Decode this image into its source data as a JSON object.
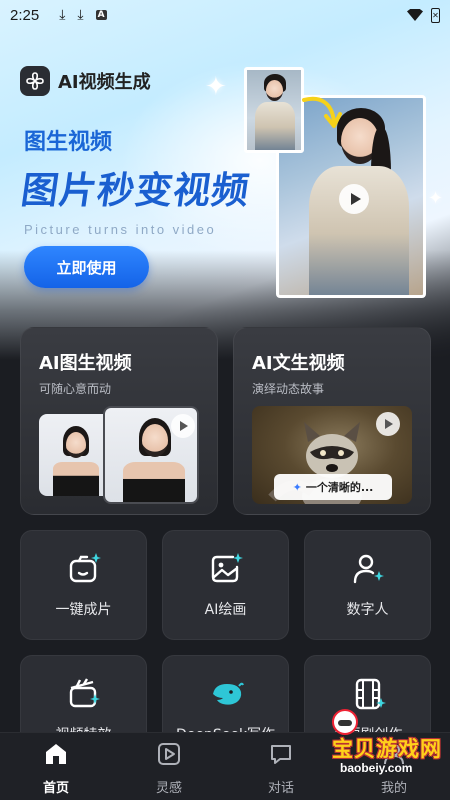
{
  "status": {
    "time": "2:25",
    "icons": [
      "download-icon",
      "download-icon",
      "a-badge-icon"
    ]
  },
  "app": {
    "title": "AI视频生成"
  },
  "hero": {
    "subtitle": "图生视频",
    "headline": "图片秒变视频",
    "english": "Picture turns into video",
    "cta_label": "立即使用"
  },
  "features": [
    {
      "title": "AI图生视频",
      "subtitle": "可随心意而动"
    },
    {
      "title": "AI文生视频",
      "subtitle": "演绎动态故事",
      "prompt": "一个清晰的..."
    }
  ],
  "tools": [
    {
      "label": "一键成片",
      "icon": "camera-sparkle-icon"
    },
    {
      "label": "AI绘画",
      "icon": "image-sparkle-icon"
    },
    {
      "label": "数字人",
      "icon": "person-sparkle-icon"
    },
    {
      "label": "视频特效",
      "icon": "clapper-sparkle-icon"
    },
    {
      "label": "DeepSeek写作",
      "icon": "deepseek-whale-icon"
    },
    {
      "label": "AI短剧创作",
      "icon": "film-strip-icon"
    }
  ],
  "nav": [
    {
      "label": "首页",
      "icon": "home-icon",
      "active": true
    },
    {
      "label": "灵感",
      "icon": "play-square-icon",
      "active": false
    },
    {
      "label": "对话",
      "icon": "chat-icon",
      "active": false
    },
    {
      "label": "我的",
      "icon": "user-icon",
      "active": false
    }
  ],
  "watermark": {
    "text": "宝贝游戏网",
    "url": "baobeiy.com"
  },
  "colors": {
    "accent": "#1a66d6",
    "cta": "#2f86ff",
    "card": "#2c2e34",
    "background": "#1b1d22",
    "sparkle": "#3fd6e0"
  }
}
